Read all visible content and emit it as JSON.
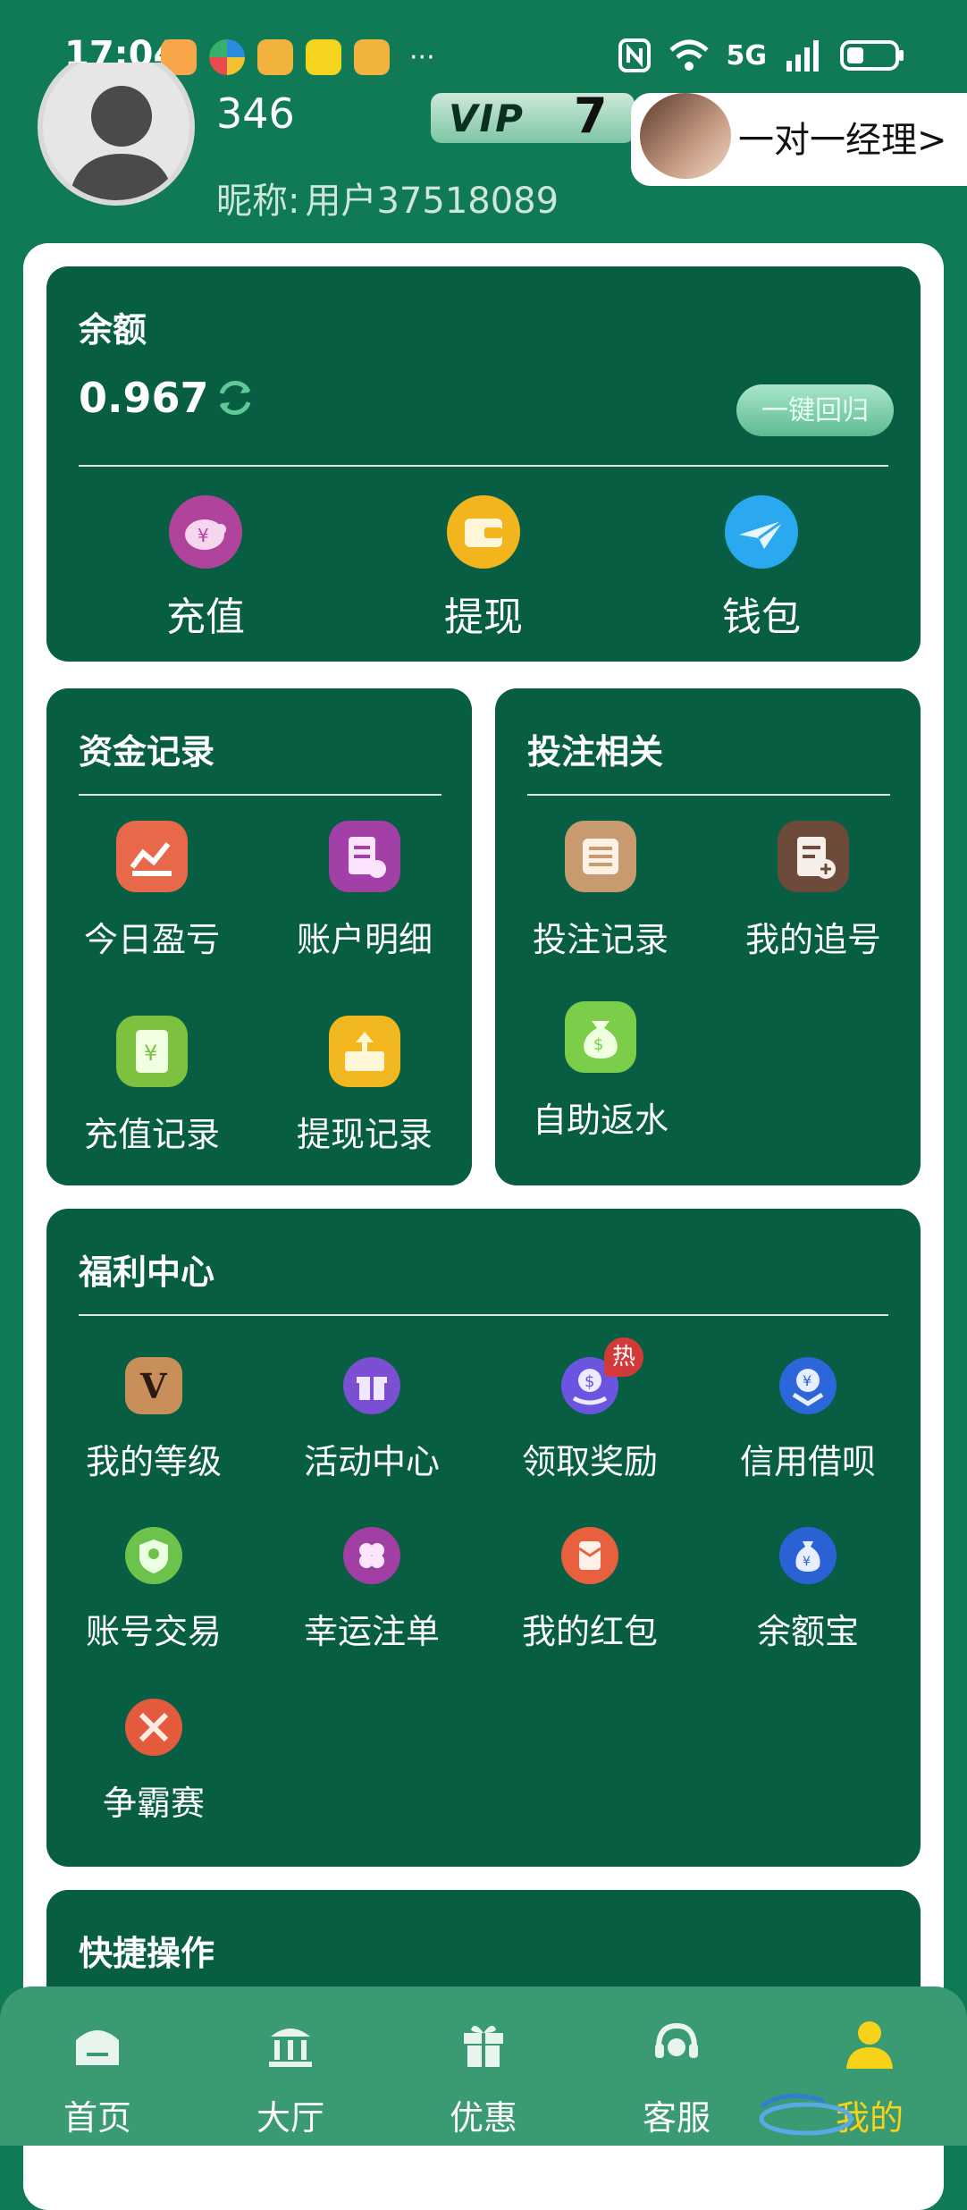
{
  "status_bar": {
    "time": "17:04",
    "network": "5G",
    "more": "···"
  },
  "profile": {
    "user_number": "346",
    "nickname_label": "昵称:",
    "nickname": "用户37518089",
    "vip_label": "VIP",
    "vip_level": "7",
    "manager_link": "一对一经理>"
  },
  "balance": {
    "title": "余额",
    "value": "0.967",
    "return_button": "一键回归",
    "actions": [
      {
        "label": "充值",
        "icon": "piggy-bank-icon",
        "color": "#b0439c"
      },
      {
        "label": "提现",
        "icon": "wallet-icon",
        "color": "#f2b51e"
      },
      {
        "label": "钱包",
        "icon": "paper-plane-icon",
        "color": "#2aa8f0"
      }
    ]
  },
  "fund_records": {
    "title": "资金记录",
    "items": [
      {
        "label": "今日盈亏",
        "icon": "chart-icon",
        "color": "#e8684a"
      },
      {
        "label": "账户明细",
        "icon": "clipboard-icon",
        "color": "#a340a8"
      },
      {
        "label": "充值记录",
        "icon": "yen-card-icon",
        "color": "#7cc23e"
      },
      {
        "label": "提现记录",
        "icon": "upload-box-icon",
        "color": "#f2b71f"
      }
    ]
  },
  "betting": {
    "title": "投注相关",
    "items": [
      {
        "label": "投注记录",
        "icon": "list-icon",
        "color": "#c79a6f"
      },
      {
        "label": "我的追号",
        "icon": "doc-add-icon",
        "color": "#6d4a3a"
      },
      {
        "label": "自助返水",
        "icon": "money-bag-icon",
        "color": "#7ccd4a"
      }
    ]
  },
  "welfare": {
    "title": "福利中心",
    "hot_badge": "热",
    "items": [
      {
        "label": "我的等级",
        "icon": "v-level-icon",
        "color": "#c98f5a"
      },
      {
        "label": "活动中心",
        "icon": "gift-icon",
        "color": "#7a4fd1"
      },
      {
        "label": "领取奖励",
        "icon": "dollar-hand-icon",
        "color": "#6b55e0"
      },
      {
        "label": "信用借呗",
        "icon": "yen-shield-icon",
        "color": "#2b67d8"
      },
      {
        "label": "账号交易",
        "icon": "account-shield-icon",
        "color": "#6cc24a"
      },
      {
        "label": "幸运注单",
        "icon": "clover-icon",
        "color": "#a23fa5"
      },
      {
        "label": "我的红包",
        "icon": "red-envelope-icon",
        "color": "#e9603f"
      },
      {
        "label": "余额宝",
        "icon": "yen-bag-icon",
        "color": "#2a62d6"
      },
      {
        "label": "争霸赛",
        "icon": "swords-icon",
        "color": "#e35b3c"
      }
    ]
  },
  "quick_ops": {
    "title": "快捷操作"
  },
  "bottom_nav": [
    {
      "label": "首页",
      "icon": "home-icon"
    },
    {
      "label": "大厅",
      "icon": "hall-icon"
    },
    {
      "label": "优惠",
      "icon": "gift-icon"
    },
    {
      "label": "客服",
      "icon": "headset-icon"
    },
    {
      "label": "我的",
      "icon": "user-icon",
      "active": true
    }
  ],
  "colors": {
    "background": "#0f7a55",
    "card": "#075e42",
    "active_nav": "#f6d21a"
  }
}
